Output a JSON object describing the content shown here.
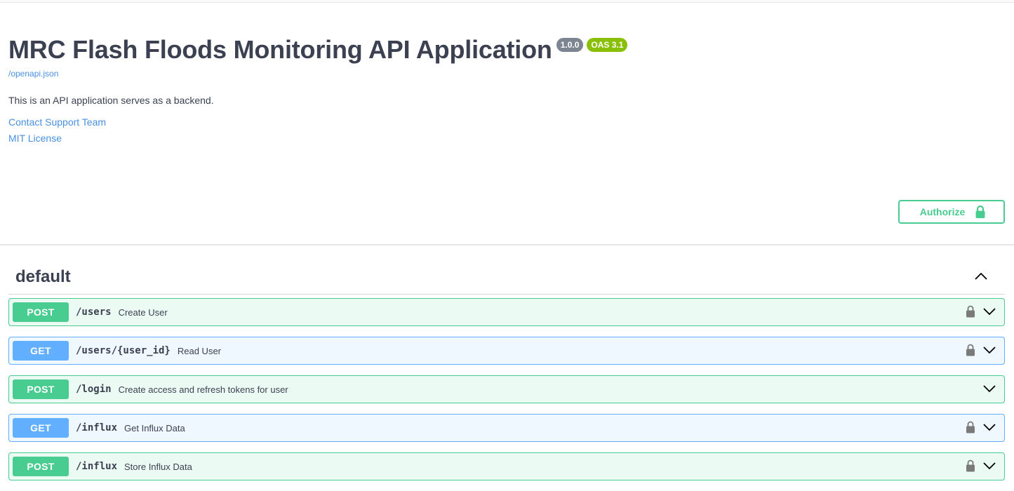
{
  "info": {
    "title": "MRC Flash Floods Monitoring API Application",
    "version": "1.0.0",
    "oas": "OAS 3.1",
    "spec_link": "/openapi.json",
    "description": "This is an API application serves as a backend.",
    "contact": "Contact Support Team",
    "license": "MIT License"
  },
  "authorize": {
    "label": "Authorize",
    "icon": "lock-icon"
  },
  "section": {
    "title": "default",
    "state": "expanded",
    "icon": "chevron-up-icon"
  },
  "operations": [
    {
      "method": "POST",
      "path": "/users",
      "summary": "Create User",
      "locked": true
    },
    {
      "method": "GET",
      "path": "/users/{user_id}",
      "summary": "Read User",
      "locked": true
    },
    {
      "method": "POST",
      "path": "/login",
      "summary": "Create access and refresh tokens for user",
      "locked": false
    },
    {
      "method": "GET",
      "path": "/influx",
      "summary": "Get Influx Data",
      "locked": true
    },
    {
      "method": "POST",
      "path": "/influx",
      "summary": "Store Influx Data",
      "locked": true
    }
  ],
  "colors": {
    "post": "#49cc90",
    "get": "#61afe2",
    "link": "#4990e2",
    "text": "#3b4151",
    "version_badge": "#7d8492",
    "oas_badge": "#89bf04"
  }
}
